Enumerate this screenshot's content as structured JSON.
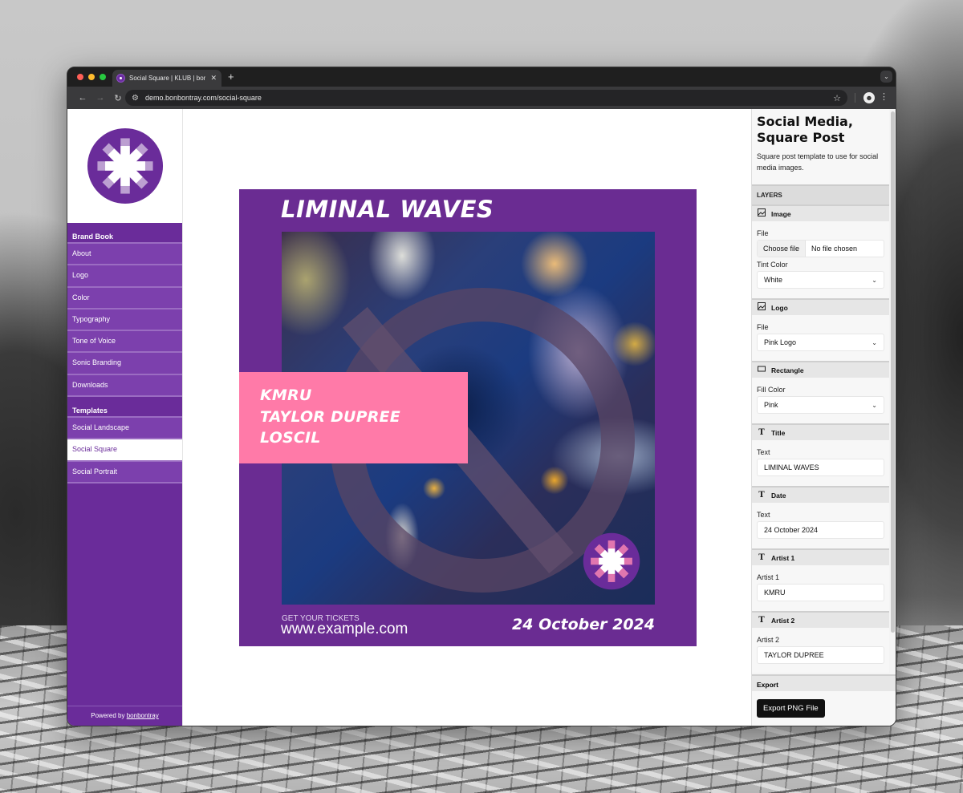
{
  "browser": {
    "tab_title": "Social Square | KLUB | bonbontray",
    "tab_close": "✕",
    "new_tab": "+",
    "url": "demo.bonbontray.com/social-square",
    "icons": {
      "back": "←",
      "forward": "→",
      "reload": "↻",
      "site_info": "⚙",
      "bookmark": "☆",
      "profile": "☻",
      "menu": "⋮",
      "tab_menu": "⌄"
    }
  },
  "sidebar": {
    "groups": [
      {
        "title": "Brand Book",
        "items": [
          {
            "label": "About"
          },
          {
            "label": "Logo"
          },
          {
            "label": "Color"
          },
          {
            "label": "Typography"
          },
          {
            "label": "Tone of Voice"
          },
          {
            "label": "Sonic Branding"
          },
          {
            "label": "Downloads"
          }
        ]
      },
      {
        "title": "Templates",
        "items": [
          {
            "label": "Social Landscape"
          },
          {
            "label": "Social Square",
            "active": true
          },
          {
            "label": "Social Portrait"
          }
        ]
      }
    ],
    "footer_prefix": "Powered by ",
    "footer_link": "bonbontray"
  },
  "post": {
    "title": "LIMINAL WAVES",
    "artists": [
      "KMRU",
      "TAYLOR DUPREE",
      "LOSCIL"
    ],
    "tickets_label": "GET YOUR TICKETS",
    "tickets_url": "www.example.com",
    "date": "24 October 2024",
    "colors": {
      "background": "#6a2c92",
      "rectangle": "#ff7aa8",
      "text": "#ffffff"
    }
  },
  "panel": {
    "title": "Social Media, Square Post",
    "description": "Square post template to use for social media images.",
    "layers_title": "LAYERS",
    "layers": {
      "image": {
        "name": "Image",
        "file_label": "File",
        "file_button": "Choose file",
        "file_status": "No file chosen",
        "tint_label": "Tint Color",
        "tint_value": "White"
      },
      "logo": {
        "name": "Logo",
        "file_label": "File",
        "file_value": "Pink Logo"
      },
      "rectangle": {
        "name": "Rectangle",
        "fill_label": "Fill Color",
        "fill_value": "Pink"
      },
      "title": {
        "name": "Title",
        "text_label": "Text",
        "text_value": "LIMINAL WAVES"
      },
      "date": {
        "name": "Date",
        "text_label": "Text",
        "text_value": "24 October 2024"
      },
      "artist1": {
        "name": "Artist 1",
        "text_label": "Artist 1",
        "text_value": "KMRU"
      },
      "artist2": {
        "name": "Artist 2",
        "text_label": "Artist 2",
        "text_value": "TAYLOR DUPREE"
      }
    },
    "export_title": "Export",
    "export_button": "Export PNG File"
  }
}
